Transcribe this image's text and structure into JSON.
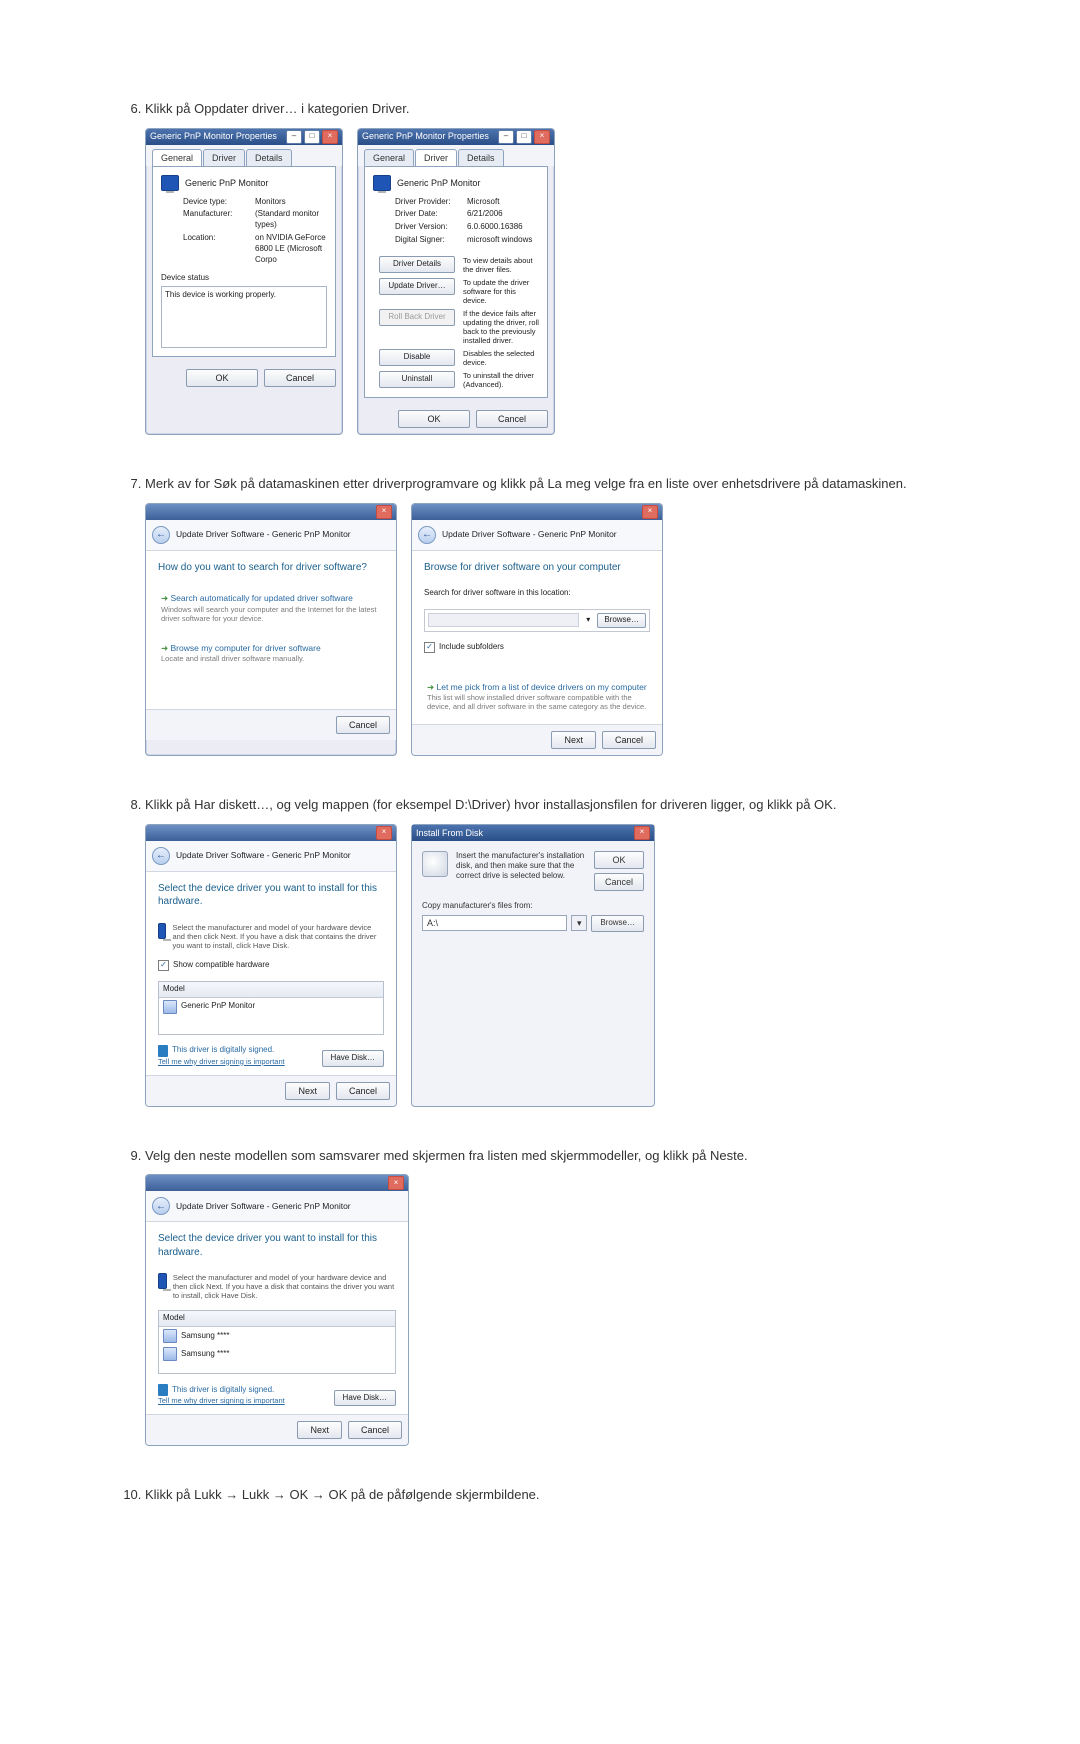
{
  "steps": {
    "s6": {
      "num": "6.",
      "text": "Klikk på Oppdater driver… i kategorien Driver."
    },
    "s7": {
      "num": "7.",
      "text": "Merk av for Søk på datamaskinen etter driverprogramvare og klikk på La meg velge fra en liste over enhetsdrivere på datamaskinen."
    },
    "s8": {
      "num": "8.",
      "text": "Klikk på Har diskett…, og velg mappen (for eksempel D:\\Driver) hvor installasjonsfilen for driveren ligger, og klikk på OK."
    },
    "s9": {
      "num": "9.",
      "text": "Velg den neste modellen som samsvarer med skjermen fra listen med skjermmodeller, og klikk på Neste."
    },
    "s10": {
      "num": "10.",
      "text": "Klikk på Lukk → Lukk → OK → OK på de påfølgende skjermbildene."
    }
  },
  "propGen": {
    "title": "Generic PnP Monitor Properties",
    "tabs": {
      "general": "General",
      "driver": "Driver",
      "details": "Details"
    },
    "name": "Generic PnP Monitor",
    "fields": {
      "devtype_k": "Device type:",
      "devtype_v": "Monitors",
      "mfr_k": "Manufacturer:",
      "mfr_v": "(Standard monitor types)",
      "loc_k": "Location:",
      "loc_v": "on NVIDIA GeForce 6800 LE (Microsoft Corpo"
    },
    "statuslabel": "Device status",
    "status": "This device is working properly.",
    "ok": "OK",
    "cancel": "Cancel"
  },
  "propDrv": {
    "title": "Generic PnP Monitor Properties",
    "name": "Generic PnP Monitor",
    "tabs": {
      "general": "General",
      "driver": "Driver",
      "details": "Details"
    },
    "fields": {
      "prov_k": "Driver Provider:",
      "prov_v": "Microsoft",
      "date_k": "Driver Date:",
      "date_v": "6/21/2006",
      "ver_k": "Driver Version:",
      "ver_v": "6.0.6000.16386",
      "sign_k": "Digital Signer:",
      "sign_v": "microsoft windows"
    },
    "btns": {
      "details": {
        "l": "Driver Details",
        "d": "To view details about the driver files."
      },
      "update": {
        "l": "Update Driver…",
        "d": "To update the driver software for this device."
      },
      "rollback": {
        "l": "Roll Back Driver",
        "d": "If the device fails after updating the driver, roll back to the previously installed driver."
      },
      "disable": {
        "l": "Disable",
        "d": "Disables the selected device."
      },
      "uninstall": {
        "l": "Uninstall",
        "d": "To uninstall the driver (Advanced)."
      }
    },
    "ok": "OK",
    "cancel": "Cancel"
  },
  "wizSearch": {
    "crumb": "Update Driver Software - Generic PnP Monitor",
    "h": "How do you want to search for driver software?",
    "opt1_t": "Search automatically for updated driver software",
    "opt1_d": "Windows will search your computer and the Internet for the latest driver software for your device.",
    "opt2_t": "Browse my computer for driver software",
    "opt2_d": "Locate and install driver software manually.",
    "cancel": "Cancel"
  },
  "wizBrowse": {
    "crumb": "Update Driver Software - Generic PnP Monitor",
    "h": "Browse for driver software on your computer",
    "label": "Search for driver software in this location:",
    "browse": "Browse…",
    "chk": "Include subfolders",
    "opt_t": "Let me pick from a list of device drivers on my computer",
    "opt_d": "This list will show installed driver software compatible with the device, and all driver software in the same category as the device.",
    "next": "Next",
    "cancel": "Cancel"
  },
  "wizPick1": {
    "crumb": "Update Driver Software - Generic PnP Monitor",
    "h": "Select the device driver you want to install for this hardware.",
    "sub": "Select the manufacturer and model of your hardware device and then click Next. If you have a disk that contains the driver you want to install, click Have Disk.",
    "chk": "Show compatible hardware",
    "model_h": "Model",
    "model1": "Generic PnP Monitor",
    "sig": "This driver is digitally signed.",
    "tell": "Tell me why driver signing is important",
    "have": "Have Disk…",
    "next": "Next",
    "cancel": "Cancel"
  },
  "ifd": {
    "title": "Install From Disk",
    "text": "Insert the manufacturer's installation disk, and then make sure that the correct drive is selected below.",
    "ok": "OK",
    "cancel": "Cancel",
    "label": "Copy manufacturer's files from:",
    "path": "A:\\",
    "browse": "Browse…"
  },
  "wizPick2": {
    "crumb": "Update Driver Software - Generic PnP Monitor",
    "h": "Select the device driver you want to install for this hardware.",
    "sub": "Select the manufacturer and model of your hardware device and then click Next. If you have a disk that contains the driver you want to install, click Have Disk.",
    "model_h": "Model",
    "model1": "Samsung ****",
    "model2": "Samsung ****",
    "sig": "This driver is digitally signed.",
    "tell": "Tell me why driver signing is important",
    "have": "Have Disk…",
    "next": "Next",
    "cancel": "Cancel"
  }
}
